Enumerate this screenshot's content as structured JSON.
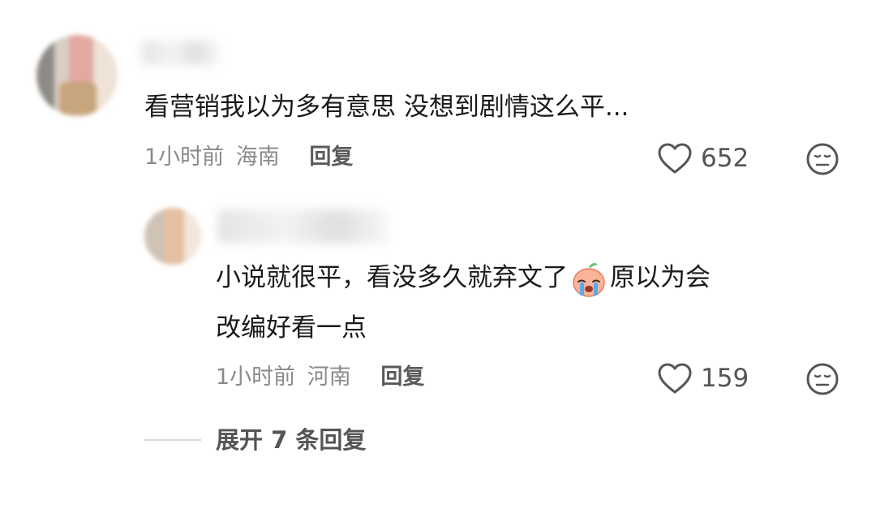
{
  "comments": [
    {
      "text": "看营销我以为多有意思 没想到剧情这么平...",
      "time": "1小时前",
      "location": "海南",
      "reply_label": "回复",
      "likes": "652"
    }
  ],
  "reply": {
    "text_line1_before_emoji": "小说就很平，看没多久就弃文了",
    "text_line1_after_emoji": "原以为会",
    "text_line2": "改编好看一点",
    "time": "1小时前",
    "location": "河南",
    "reply_label": "回复",
    "likes": "159"
  },
  "expand_replies": "展开 7 条回复",
  "icons": {
    "like": "heart-outline-icon",
    "dislike": "neutral-face-icon",
    "emoji": "crying-peach-emoji"
  },
  "colors": {
    "text_primary": "#1a1a1a",
    "text_meta": "#8a8a8a",
    "text_action": "#5a5a5a"
  }
}
